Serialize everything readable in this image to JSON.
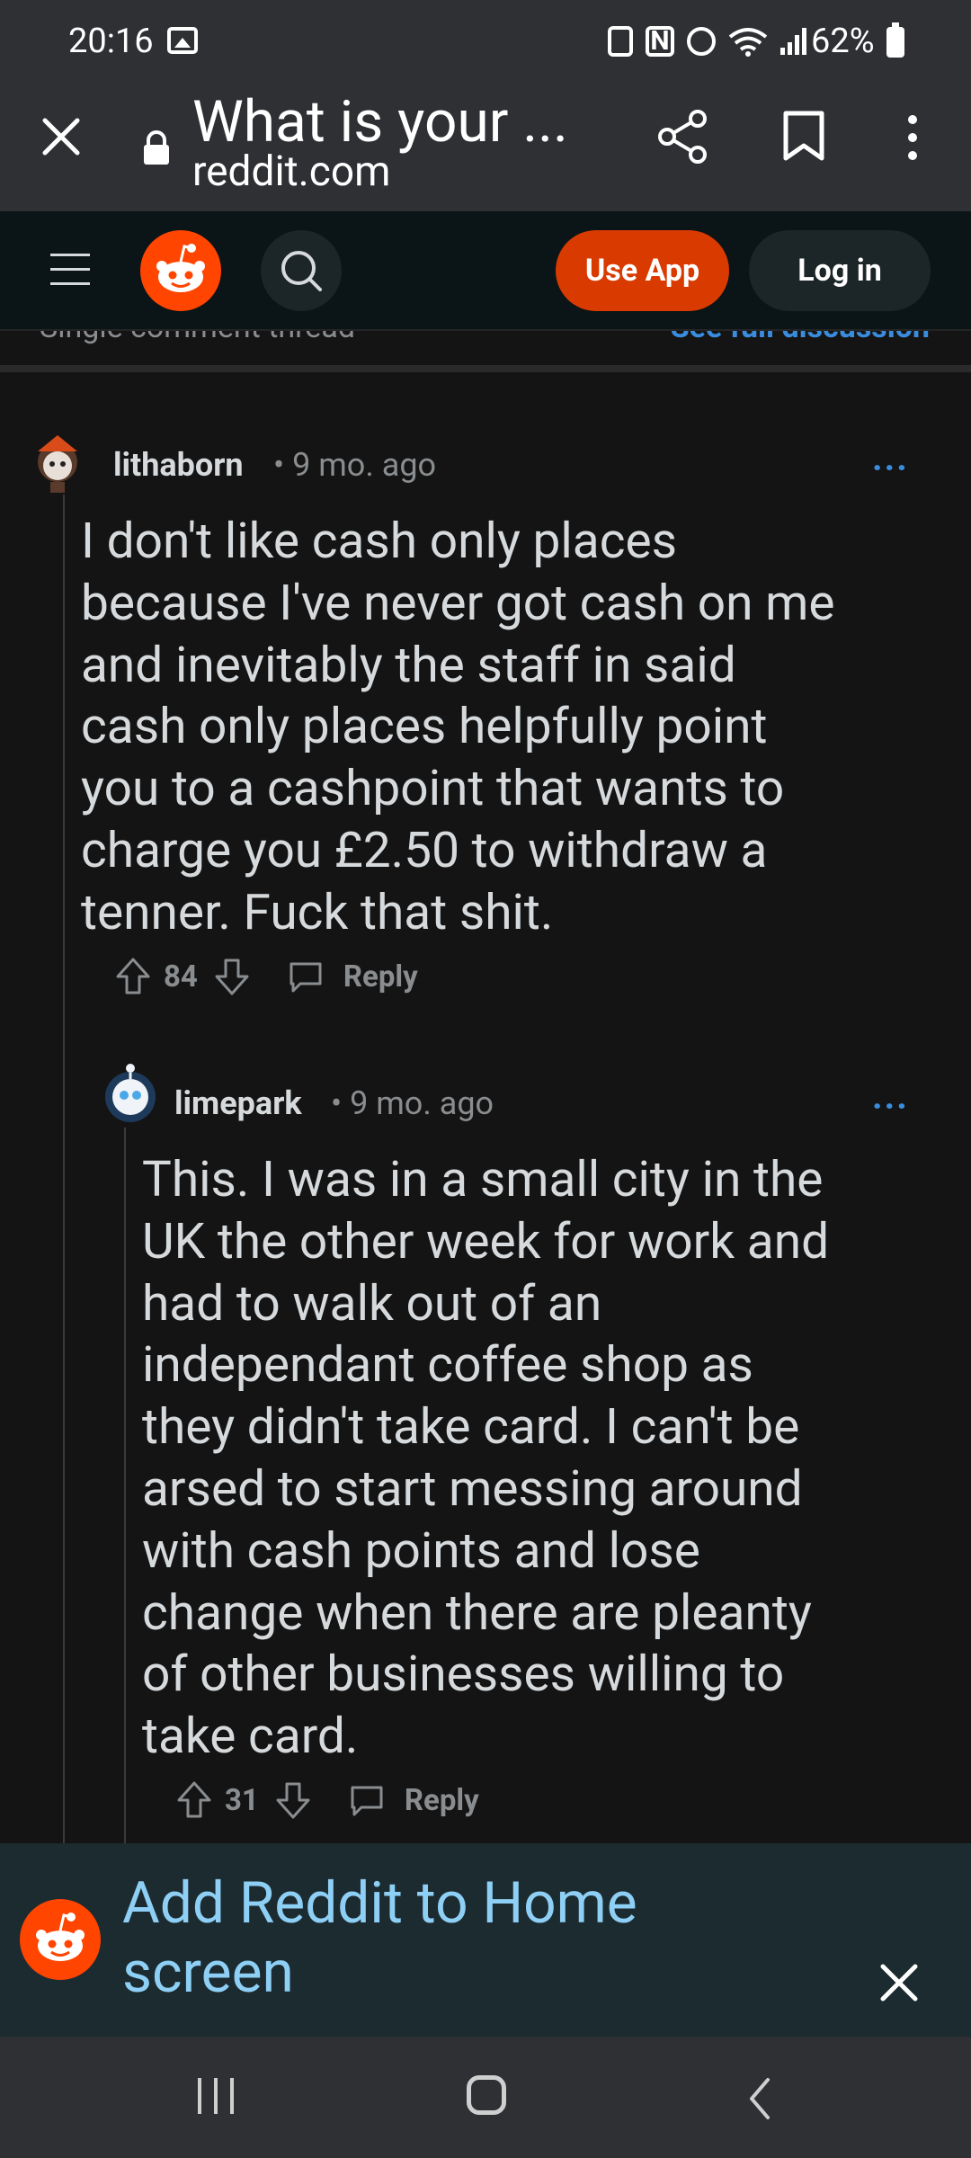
{
  "status_bar": {
    "time": "20:16",
    "nfc_label": "N",
    "battery": "62%"
  },
  "browser": {
    "title": "What is your ...",
    "url": "reddit.com"
  },
  "header": {
    "use_app_label": "Use App",
    "login_label": "Log in",
    "accent": "#d93a00"
  },
  "thread": {
    "single_comment_label": "Single comment thread",
    "see_full_label": "See full discussion"
  },
  "comments": [
    {
      "username": "lithaborn",
      "time": "• 9 mo. ago",
      "more": "...",
      "lines": [
        "I don't like cash only places",
        "because I've never got cash on me",
        "and inevitably the staff in said",
        "cash only places helpfully point",
        "you to a cashpoint that wants to",
        "charge you £2.50 to withdraw a",
        "tenner. Fuck that shit."
      ],
      "votes": "84",
      "reply_label": "Reply"
    },
    {
      "username": "limepark",
      "time": "• 9 mo. ago",
      "more": "...",
      "lines": [
        "This. I was in a small city in the",
        "UK the other week for work and",
        "had to walk out of an",
        "independant coffee shop as",
        "they didn't take card. I can't be",
        "arsed to start messing around",
        "with cash points and lose",
        "change when there are pleanty",
        "of other businesses willing to",
        "take card."
      ],
      "votes": "31",
      "reply_label": "Reply"
    }
  ],
  "banner": {
    "text": "Add Reddit to Home screen"
  }
}
